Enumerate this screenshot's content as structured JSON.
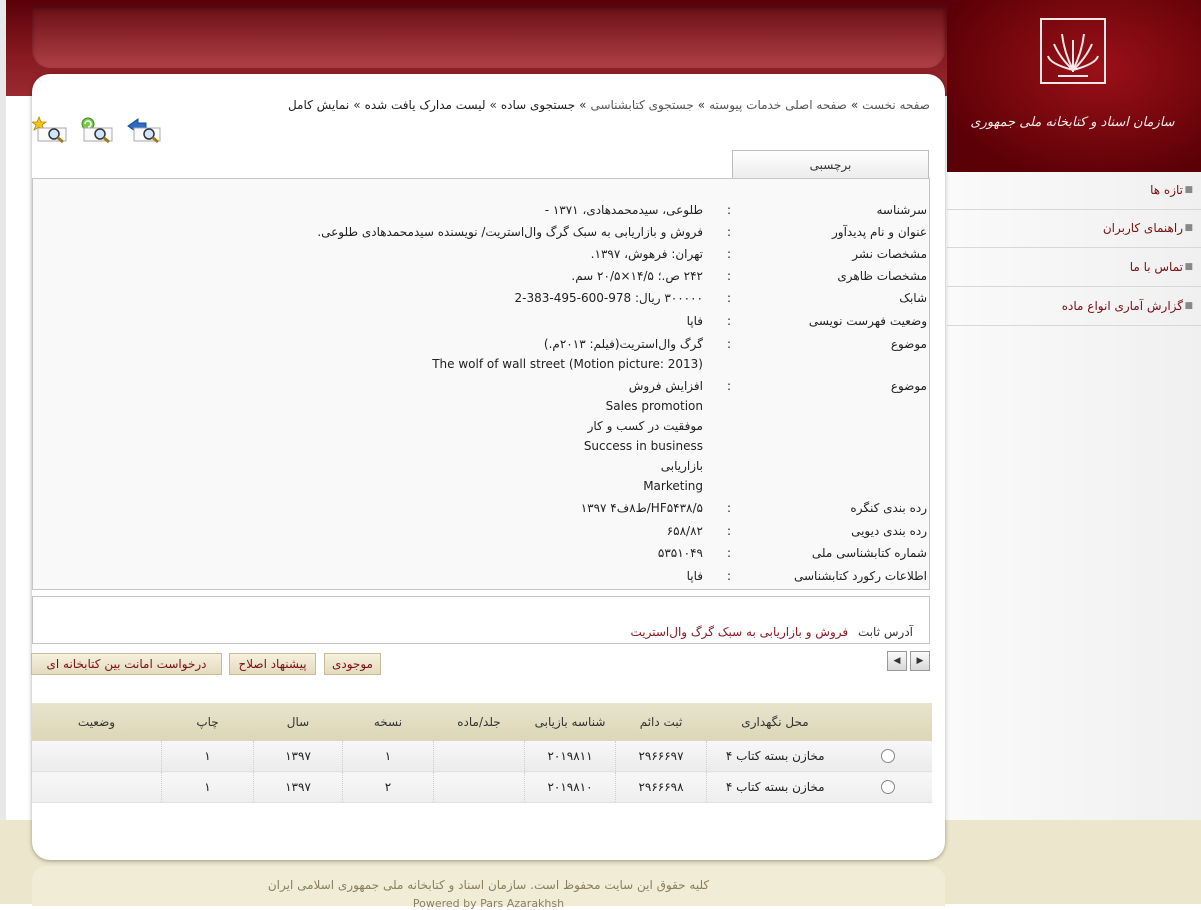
{
  "sidebar": {
    "items": [
      {
        "label": "تازه ها"
      },
      {
        "label": "راهنمای کاربران"
      },
      {
        "label": "تماس با ما"
      },
      {
        "label": "گزارش آماری انواع ماده"
      }
    ]
  },
  "logo": {
    "text": "سازمان اسناد و کتابخانه ملی جمهوری اسلامی ایران"
  },
  "breadcrumb": {
    "items": [
      {
        "label": "صفحه نخست"
      },
      {
        "label": "صفحه اصلی خدمات پیوسته"
      },
      {
        "label": "جستجوی کتابشناسی"
      },
      {
        "label": "جستجوی ساده"
      },
      {
        "label": "لیست مدارک یافت شده"
      },
      {
        "label": "نمایش کامل"
      }
    ]
  },
  "toolbar": {
    "icons": [
      "back-search-icon",
      "refresh-search-icon",
      "new-search-icon"
    ]
  },
  "tab": {
    "label": "برچسبی"
  },
  "record": {
    "sep": ":",
    "fields": [
      {
        "label": "سرشناسه",
        "value": "طلوعی، سیدمحمدهادی، ۱۳۷۱ -"
      },
      {
        "label": "عنوان و نام پدیدآور",
        "value": "فروش و بازاریابی به سبک گرگ وال‌استریت/ نویسنده سیدمحمدهادی طلوعی."
      },
      {
        "label": "مشخصات نشر",
        "value": "تهران: فرهوش، ۱۳۹۷."
      },
      {
        "label": "مشخصات ظاهری",
        "value": "۲۴۲ ص.؛ ۱۴/۵×۲۰/۵ سم."
      },
      {
        "label": "شابک",
        "value": "۳۰۰۰۰۰ ریال: 978-600-495-383-2"
      },
      {
        "label": "وضعیت فهرست نویسی",
        "value": "فاپا"
      },
      {
        "label": "موضوع",
        "values": [
          "گرگ وال‌استریت(فیلم: ۲۰۱۳م.)",
          "The wolf of wall street (Motion picture: 2013)"
        ]
      },
      {
        "label": "موضوع",
        "values": [
          "افزایش فروش",
          "Sales promotion",
          "موفقیت در کسب و کار",
          "Success in business",
          "بازاریابی",
          "Marketing"
        ]
      },
      {
        "label": "رده بندی کنگره",
        "value": "HF۵۴۳۸/۵/ط۸ف۴ ۱۳۹۷"
      },
      {
        "label": "رده بندی دیویی",
        "value": "۶۵۸/۸۲"
      },
      {
        "label": "شماره کتابشناسی ملی",
        "value": "۵۳۵۱۰۴۹"
      },
      {
        "label": "اطلاعات رکورد کتابشناسی",
        "value": "فاپا"
      }
    ]
  },
  "address": {
    "label": "آدرس ثابت",
    "link": "فروش و بازاریابی به سبک گرگ وال‌استریت"
  },
  "actions": {
    "availability": "موجودی",
    "suggest": "پیشنهاد اصلاح",
    "ill": "درخواست امانت بین کتابخانه ای"
  },
  "holdings": {
    "headers": [
      "",
      "محل نگهداری",
      "ثبت دائم",
      "شناسه بازیابی",
      "جلد/ماده",
      "نسخه",
      "سال",
      "چاپ",
      "وضعیت"
    ],
    "rows": [
      [
        "",
        "مخازن بسته کتاب ۴",
        "۲۹۶۶۶۹۷",
        "۲۰۱۹۸۱۱",
        "",
        "۱",
        "۱۳۹۷",
        "۱",
        ""
      ],
      [
        "",
        "مخازن بسته کتاب ۴",
        "۲۹۶۶۶۹۸",
        "۲۰۱۹۸۱۰",
        "",
        "۲",
        "۱۳۹۷",
        "۱",
        ""
      ]
    ]
  },
  "footer": {
    "copyright": "کلیه حقوق این سایت محفوظ است. سازمان اسناد و کتابخانه ملی جمهوری اسلامی ایران",
    "powered": "Powered by Pars Azarakhsh"
  },
  "colors": {
    "brand": "#8a1a22",
    "accent": "#ece6cd"
  }
}
